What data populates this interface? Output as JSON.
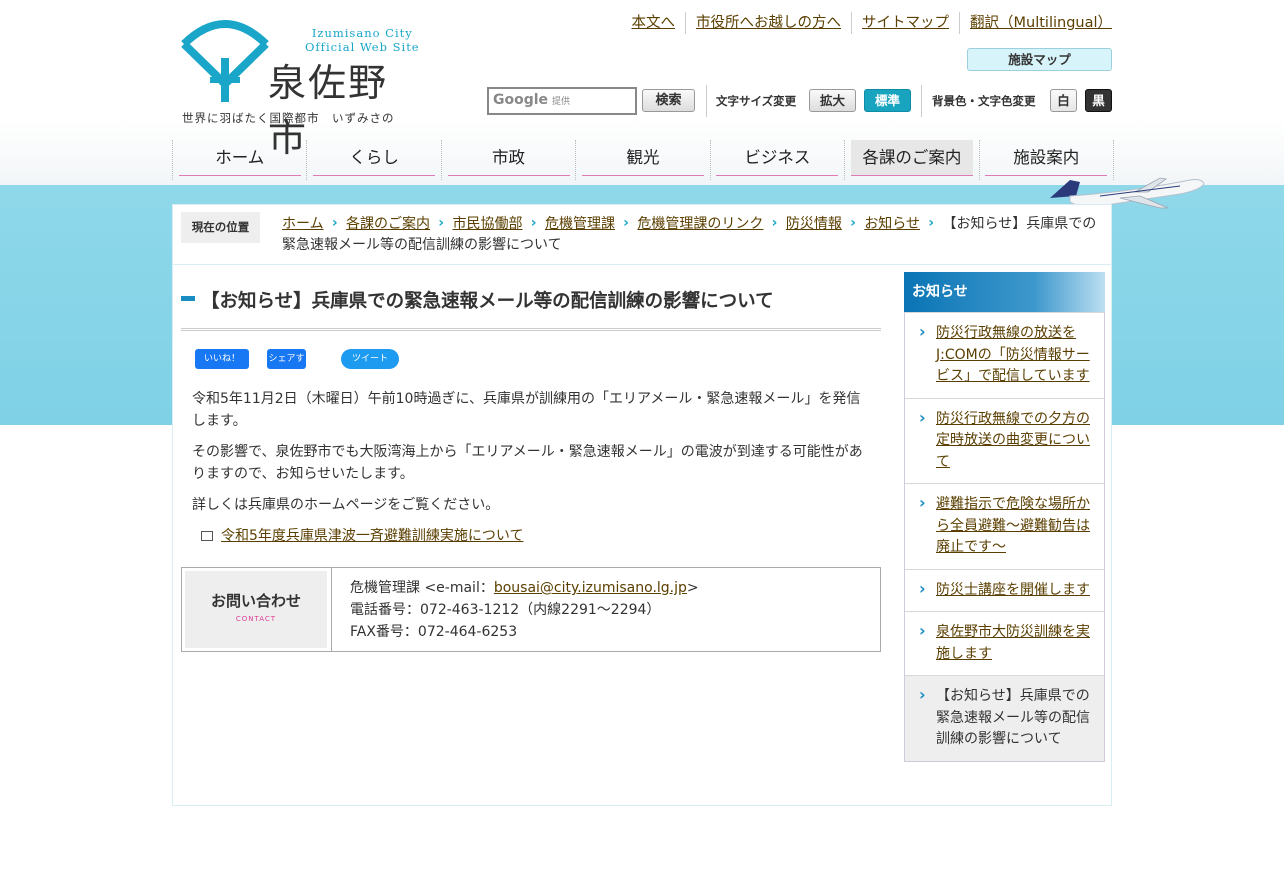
{
  "header": {
    "logo_en_line1": "Izumisano City",
    "logo_en_line2": "Official Web Site",
    "logo_jp": "泉佐野市",
    "logo_tagline": "世界に羽ばたく国際都市　いずみさの",
    "top_links": [
      "本文へ",
      "市役所へお越しの方へ",
      "サイトマップ",
      "翻訳（Multilingual）"
    ],
    "facility_map": "施設マップ",
    "search_provider": "Google",
    "search_provider_suffix": "提供",
    "search_button": "検索",
    "font_size_label": "文字サイズ変更",
    "font_large": "拡大",
    "font_standard": "標準",
    "color_label": "背景色・文字色変更",
    "color_white": "白",
    "color_black": "黒"
  },
  "nav": [
    "ホーム",
    "くらし",
    "市政",
    "観光",
    "ビジネス",
    "各課のご案内",
    "施設案内"
  ],
  "nav_active_index": 5,
  "breadcrumb": {
    "label": "現在の位置",
    "items": [
      "ホーム",
      "各課のご案内",
      "市民協働部",
      "危機管理課",
      "危機管理課のリンク",
      "防災情報",
      "お知らせ"
    ],
    "current": "【お知らせ】兵庫県での緊急速報メール等の配信訓練の影響について"
  },
  "article": {
    "title": "【お知らせ】兵庫県での緊急速報メール等の配信訓練の影響について",
    "social": {
      "like": "いいね！",
      "share": "シェアする",
      "tweet": "ツイート"
    },
    "paragraphs": [
      "令和5年11月2日（木曜日）午前10時過ぎに、兵庫県が訓練用の「エリアメール・緊急速報メール」を発信します。",
      "その影響で、泉佐野市でも大阪湾海上から「エリアメール・緊急速報メール」の電波が到達する可能性がありますので、お知らせいたします。",
      "詳しくは兵庫県のホームページをご覧ください。"
    ],
    "link": "令和5年度兵庫県津波一斉避難訓練実施について"
  },
  "contact": {
    "label": "お問い合わせ",
    "label_en": "CONTACT",
    "dept_prefix": "危機管理課 <e-mail：",
    "email": "bousai@city.izumisano.lg.jp",
    "dept_suffix": ">",
    "phone": "電話番号：072-463-1212（内線2291～2294）",
    "fax": "FAX番号：072-464-6253"
  },
  "sidebar": {
    "heading": "お知らせ",
    "items": [
      "防災行政無線の放送をJ:COMの「防災情報サービス」で配信しています",
      "防災行政無線での夕方の定時放送の曲変更について",
      "避難指示で危険な場所から全員避難～避難勧告は廃止です～",
      "防災士講座を開催します",
      "泉佐野市大防災訓練を実施します",
      "【お知らせ】兵庫県での緊急速報メール等の配信訓練の影響について"
    ]
  },
  "colors": {
    "accent": "#19a6c9",
    "link": "#5b3f00",
    "nav_underline": "#e07ab4",
    "sky": "#8fd8ea"
  }
}
